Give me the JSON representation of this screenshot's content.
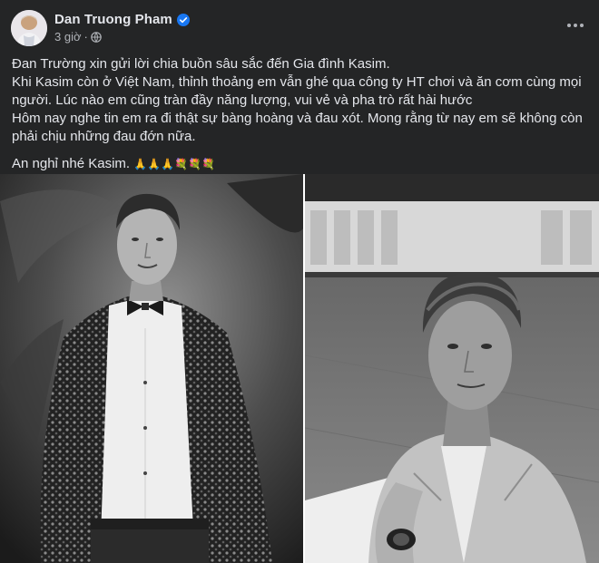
{
  "post": {
    "author": "Dan Truong Pham",
    "time": "3 giờ",
    "separator": "·",
    "icons": {
      "avatar": "profile-avatar",
      "verified": "verified-badge-icon",
      "audience": "globe-icon",
      "more": "more-options-icon"
    },
    "colors": {
      "verified": "#1877f2",
      "background": "#242526",
      "text": "#e4e6eb",
      "muted": "#b0b3b8"
    },
    "lines": [
      "Đan Trường xin gửi lời chia buồn sâu sắc đến Gia đình Kasim.",
      "Khi Kasim còn ở Việt Nam, thỉnh thoảng em vẫn ghé qua công ty HT chơi và ăn cơm cùng mọi",
      "người. Lúc nào em cũng tràn đầy năng lượng, vui vẻ và pha trò rất hài hước",
      "Hôm nay nghe tin em ra đi thật sự bàng hoàng và đau xót. Mong rằng từ nay em sẽ không còn",
      "phải chịu những đau đớn nữa."
    ],
    "closing": "An nghỉ nhé Kasim.",
    "closing_emojis": "🙏🙏🙏💐💐💐"
  }
}
